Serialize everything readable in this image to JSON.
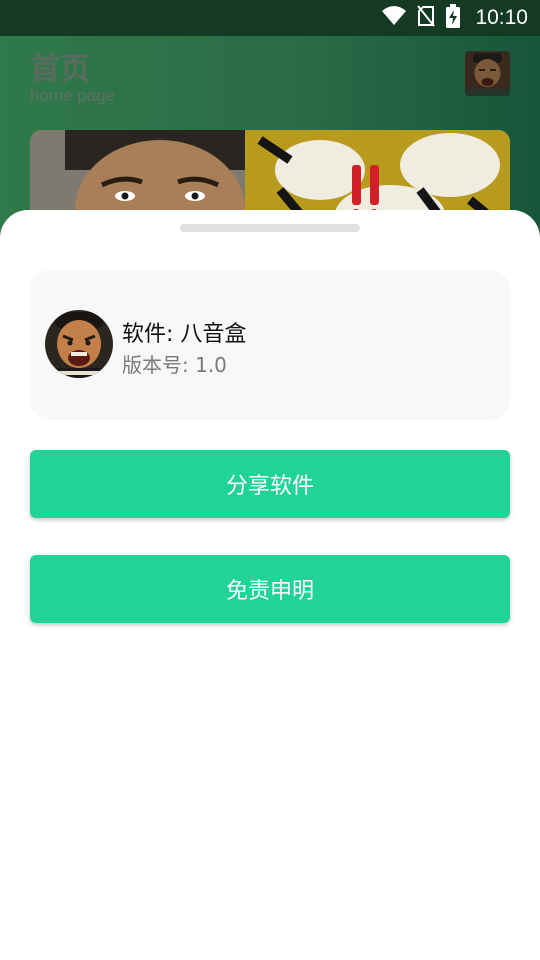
{
  "status_bar": {
    "time": "10:10",
    "icons": [
      "wifi-icon",
      "no-sim-icon",
      "battery-charging-icon"
    ]
  },
  "home": {
    "title": "首页",
    "subtitle": "home page"
  },
  "sheet": {
    "app_name": "软件: 八音盒",
    "version": "版本号: 1.0",
    "share_label": "分享软件",
    "disclaimer_label": "免责申明"
  },
  "colors": {
    "accent": "#22d396",
    "status_bar": "#143a24",
    "card_bg": "#f8f8f8"
  }
}
